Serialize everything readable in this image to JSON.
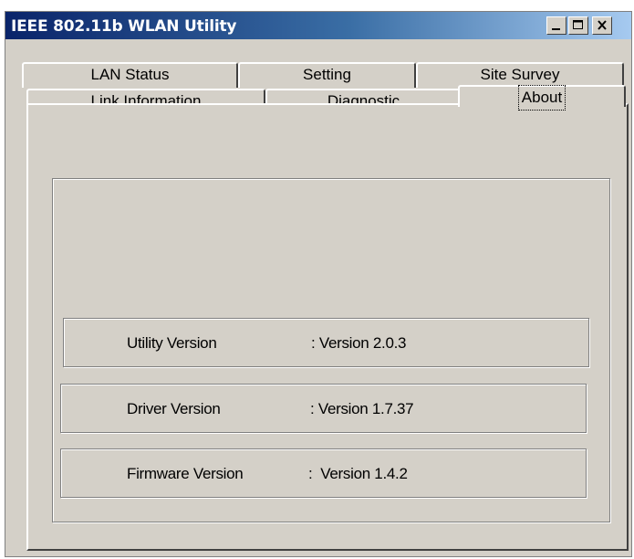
{
  "window": {
    "title": "IEEE 802.11b WLAN Utility",
    "controls": [
      "minimize-icon",
      "maximize-icon",
      "close-icon"
    ]
  },
  "tabs": {
    "back_row": [
      {
        "label": "LAN Status"
      },
      {
        "label": "Setting"
      },
      {
        "label": "Site Survey"
      }
    ],
    "front_row": [
      {
        "label": "Link Information"
      },
      {
        "label": "Diagnostic"
      },
      {
        "label": "About"
      }
    ],
    "active": "About"
  },
  "about": {
    "utility": {
      "label": "Utility Version",
      "value": ": Version 2.0.3"
    },
    "driver": {
      "label": "Driver Version",
      "value": ": Version 1.7.37"
    },
    "firmware": {
      "label": "Firmware Version",
      "value": ":  Version 1.4.2"
    }
  },
  "colors": {
    "face": "#d4d0c8",
    "title_start": "#0a246a",
    "title_end": "#a6caf0"
  }
}
